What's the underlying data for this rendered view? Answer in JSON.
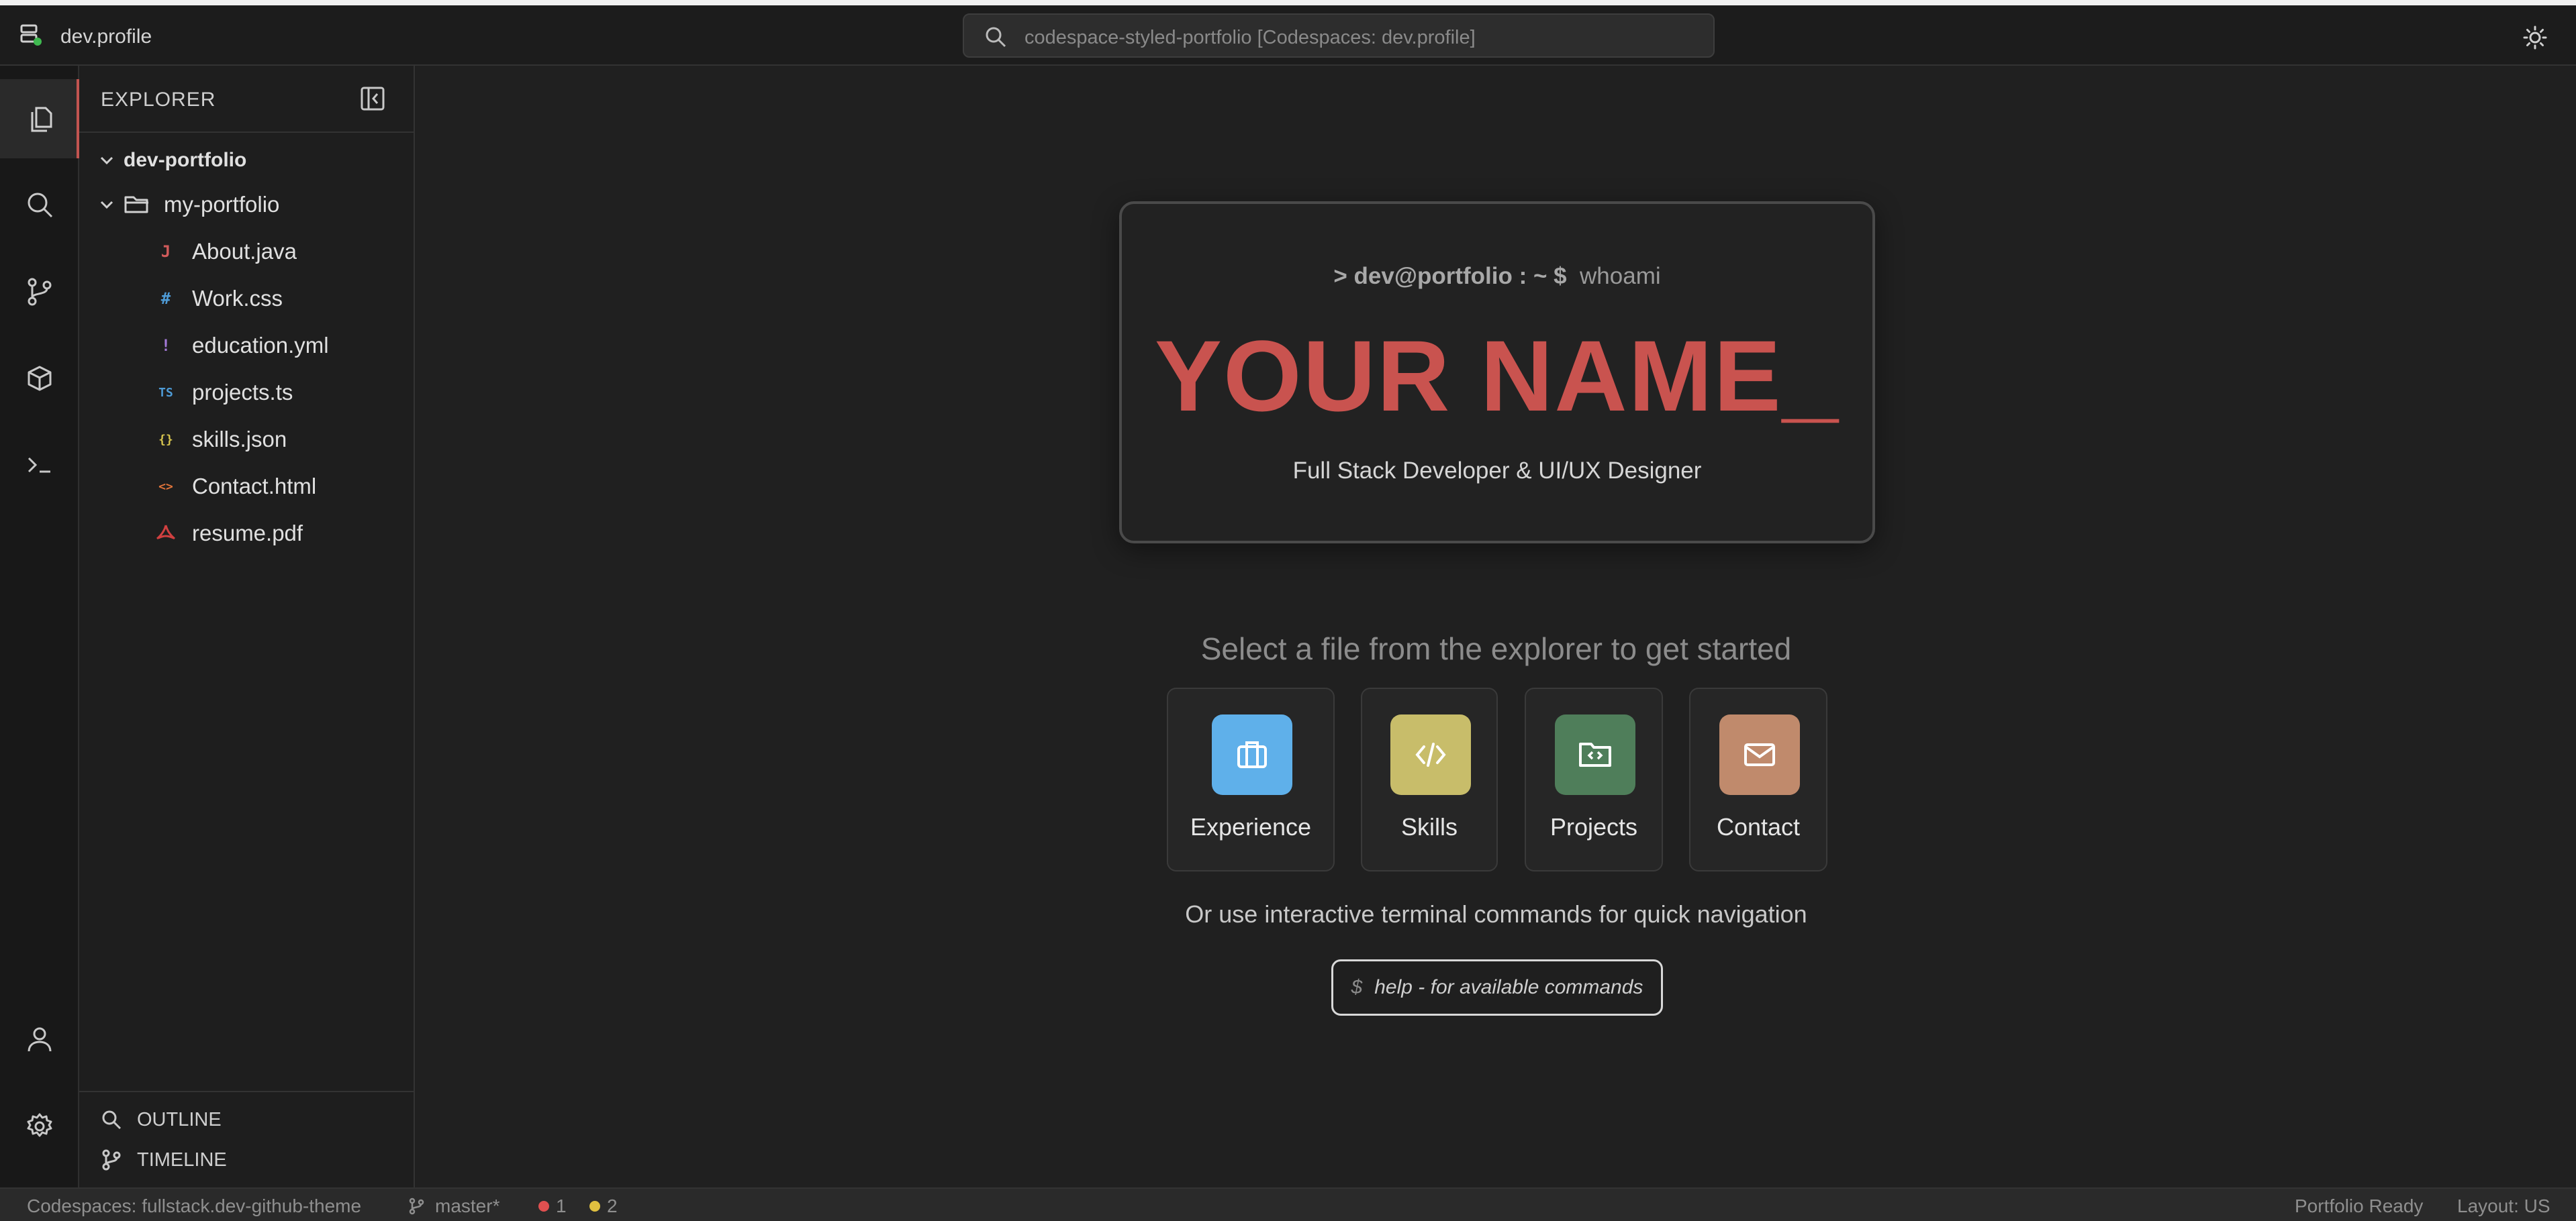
{
  "titlebar": {
    "app_title": "dev.profile",
    "search_placeholder": "codespace-styled-portfolio [Codespaces: dev.profile]"
  },
  "activity_bar": {
    "items": [
      "files-icon",
      "search-icon",
      "source-control-icon",
      "extensions-icon",
      "terminal-icon"
    ],
    "bottom_items": [
      "account-icon",
      "settings-icon"
    ]
  },
  "sidebar": {
    "header": "EXPLORER",
    "root": "dev-portfolio",
    "folder": "my-portfolio",
    "files": [
      {
        "name": "About.java",
        "icon": "J",
        "color": "#d05a5a"
      },
      {
        "name": "Work.css",
        "icon": "#",
        "color": "#4e9bd6"
      },
      {
        "name": "education.yml",
        "icon": "!",
        "color": "#a479d8"
      },
      {
        "name": "projects.ts",
        "icon": "TS",
        "color": "#4e9bd6"
      },
      {
        "name": "skills.json",
        "icon": "{}",
        "color": "#d6c44e"
      },
      {
        "name": "Contact.html",
        "icon": "<>",
        "color": "#e0743a"
      },
      {
        "name": "resume.pdf",
        "icon": "pdf",
        "color": "#d04040"
      }
    ],
    "outline": "OUTLINE",
    "timeline": "TIMELINE"
  },
  "main": {
    "prompt_user": "> dev@portfolio : ~ $",
    "prompt_cmd": "whoami",
    "name": "YOUR NAME_",
    "role": "Full Stack Developer & UI/UX Designer",
    "select_message": "Select a file from the explorer to get started",
    "cards": [
      {
        "label": "Experience",
        "color": "#5fb0ea",
        "icon": "briefcase-icon"
      },
      {
        "label": "Skills",
        "color": "#c8bd6a",
        "icon": "code-icon"
      },
      {
        "label": "Projects",
        "color": "#4f7e5a",
        "icon": "folder-code-icon"
      },
      {
        "label": "Contact",
        "color": "#c08a6c",
        "icon": "mail-icon"
      }
    ],
    "terminal_hint": "Or use interactive terminal commands for quick navigation",
    "help_prefix": "$",
    "help_text": "help - for available commands"
  },
  "statusbar": {
    "codespace": "Codespaces: fullstack.dev-github-theme",
    "branch": "master*",
    "errors": "1",
    "warnings": "2",
    "ready": "Portfolio Ready",
    "layout": "Layout: US",
    "error_color": "#e05050",
    "warning_color": "#e0c040"
  }
}
